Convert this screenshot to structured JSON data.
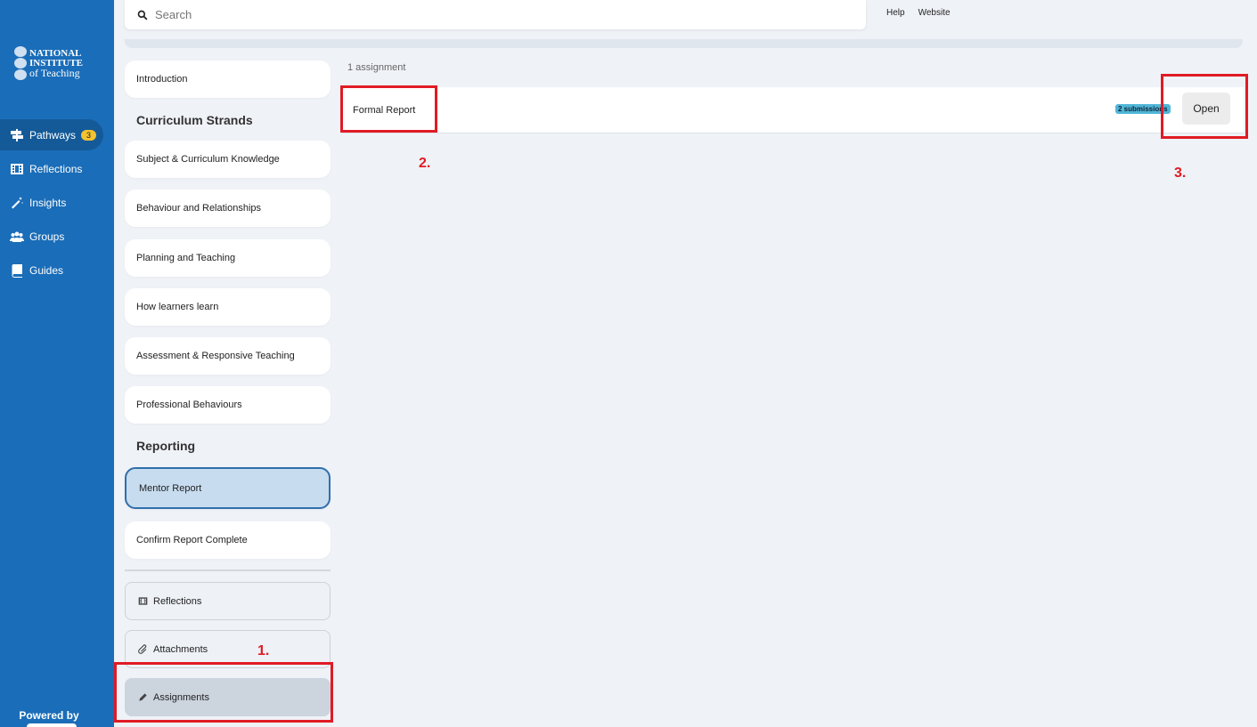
{
  "brand": {
    "logo_line1": "NATIONAL",
    "logo_line2": "INSTITUTE",
    "logo_line3": "of Teaching",
    "powered_by": "Powered by"
  },
  "nav": {
    "items": [
      {
        "label": "Pathways",
        "icon": "signpost-icon",
        "badge": "3"
      },
      {
        "label": "Reflections",
        "icon": "film-icon"
      },
      {
        "label": "Insights",
        "icon": "magic-wand-icon"
      },
      {
        "label": "Groups",
        "icon": "users-icon"
      },
      {
        "label": "Guides",
        "icon": "book-icon"
      }
    ]
  },
  "search": {
    "placeholder": "Search"
  },
  "top_links": {
    "help": "Help",
    "website": "Website"
  },
  "panel": {
    "introduction": "Introduction",
    "curriculum_title": "Curriculum Strands",
    "strands": [
      "Subject & Curriculum Knowledge",
      "Behaviour and Relationships",
      "Planning and Teaching",
      "How learners learn",
      "Assessment & Responsive Teaching",
      "Professional Behaviours"
    ],
    "reporting_title": "Reporting",
    "reporting": [
      "Mentor Report",
      "Confirm Report Complete"
    ],
    "tools": [
      {
        "label": "Reflections",
        "icon": "film-icon"
      },
      {
        "label": "Attachments",
        "icon": "paperclip-icon"
      },
      {
        "label": "Assignments",
        "icon": "pencil-icon"
      }
    ]
  },
  "main": {
    "count": "1 assignment",
    "assignment": {
      "title": "Formal Report",
      "badge": "2 submissions",
      "open_label": "Open"
    }
  },
  "annotations": [
    "1.",
    "2.",
    "3."
  ],
  "colors": {
    "sidebar": "#1a6db8",
    "badge": "#f2c230",
    "annotation": "#e01b24",
    "submission_badge": "#50b6d8"
  }
}
